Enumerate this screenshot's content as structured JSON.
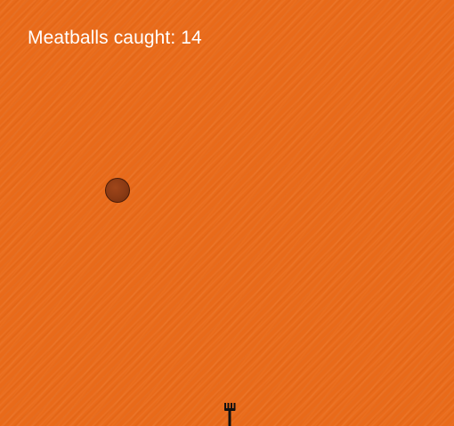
{
  "game": {
    "score_label": "Meatballs caught:",
    "score_value": "14",
    "score_text": "Meatballs caught: 14",
    "background_color": "#e96a19",
    "meatball_color": "#8a3a14",
    "fork_color": "#111111"
  },
  "sprites": {
    "meatball": "meatball-sprite",
    "fork": "fork-icon"
  }
}
